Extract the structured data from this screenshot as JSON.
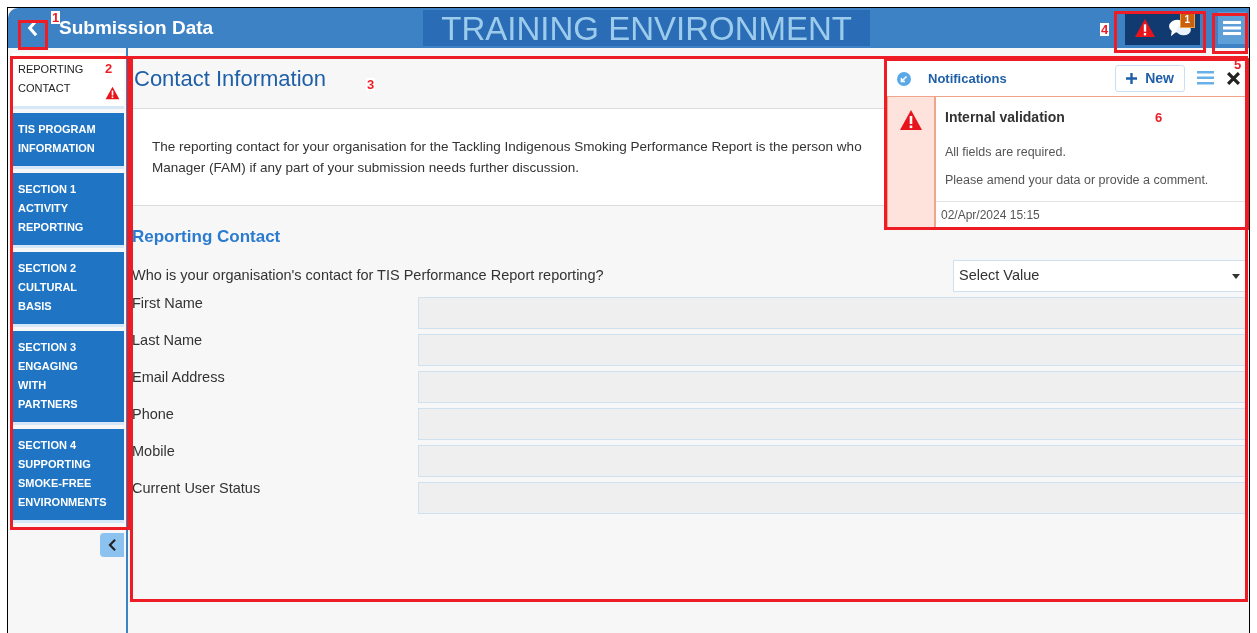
{
  "header": {
    "title": "Submission Data",
    "banner": "TRAINING ENVIRONMENT",
    "comment_count": "1"
  },
  "sidebar": {
    "items": [
      {
        "lines": [
          "REPORTING",
          "CONTACT"
        ],
        "selected": true,
        "warning": true
      },
      {
        "lines": [
          "TIS PROGRAM",
          "INFORMATION"
        ],
        "selected": false,
        "warning": false
      },
      {
        "lines": [
          "SECTION 1",
          "ACTIVITY",
          "REPORTING"
        ],
        "selected": false,
        "warning": false
      },
      {
        "lines": [
          "SECTION 2",
          "CULTURAL",
          "BASIS"
        ],
        "selected": false,
        "warning": false
      },
      {
        "lines": [
          "SECTION 3",
          "ENGAGING",
          "WITH",
          "PARTNERS"
        ],
        "selected": false,
        "warning": false
      },
      {
        "lines": [
          "SECTION 4",
          "SUPPORTING",
          "SMOKE-FREE",
          "ENVIRONMENTS"
        ],
        "selected": false,
        "warning": false
      }
    ]
  },
  "page": {
    "title": "Contact Information",
    "intro": [
      "The reporting contact for your organisation for the Tackling Indigenous Smoking Performance Report is the person who",
      "Manager (FAM) if any part of your submission needs further discussion."
    ],
    "section_title": "Reporting Contact",
    "question": "Who is your organisation's contact for TIS Performance Report reporting?",
    "select": {
      "placeholder": "Select Value"
    },
    "fields": [
      {
        "label": "First Name"
      },
      {
        "label": "Last Name"
      },
      {
        "label": "Email Address"
      },
      {
        "label": "Phone"
      },
      {
        "label": "Mobile"
      },
      {
        "label": "Current User Status"
      }
    ]
  },
  "notifications": {
    "title": "Notifications",
    "new_button": "New",
    "items": [
      {
        "title": "Internal validation",
        "lines": [
          "All fields are required.",
          "Please amend your data or provide a comment."
        ],
        "date": "02/Apr/2024 15:15"
      }
    ]
  },
  "annotations": [
    {
      "label": "1"
    },
    {
      "label": "2"
    },
    {
      "label": "3"
    },
    {
      "label": "4"
    },
    {
      "label": "5"
    },
    {
      "label": "6"
    }
  ]
}
